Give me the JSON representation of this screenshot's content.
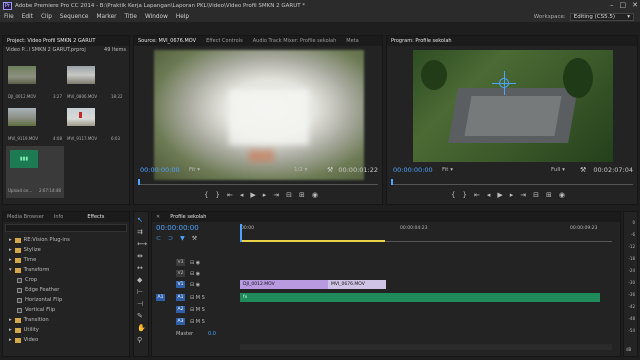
{
  "app": {
    "title": "Adobe Premiere Pro CC 2014 - B:\\Praktik Kerja Lapangan\\Laporan PKL\\Video\\Video Profil SMKN 2 GARUT *",
    "icon_label": "Pr",
    "window_buttons": [
      "–",
      "□",
      "✕"
    ]
  },
  "menu": [
    "File",
    "Edit",
    "Clip",
    "Sequence",
    "Marker",
    "Title",
    "Window",
    "Help"
  ],
  "workspace": {
    "label": "Workspace:",
    "value": "Editing (CS5.5)"
  },
  "project": {
    "tab": "Project: Video Profil SMKN 2 GARUT",
    "name": "Video P...l SMKN 2 GARUT.prproj",
    "count": "49 Items",
    "items": [
      {
        "name": "DJI_0012.MOV",
        "dur": "3:27"
      },
      {
        "name": "MVI_0806.MOV",
        "dur": "18:22"
      },
      {
        "name": "MVI_9119.MOV",
        "dur": "4:08"
      },
      {
        "name": "MVI_9117.MOV",
        "dur": "6:03"
      },
      {
        "name": "Upload on...",
        "dur": "2:07:14:48"
      }
    ]
  },
  "source": {
    "tabs": [
      "Source: MVI_0676.MOV",
      "Effect Controls",
      "Audio Track Mixer: Profile sekolah",
      "Meta"
    ],
    "timecode": "00:00:00:00",
    "fit": "Fit",
    "ratio": "1/2",
    "duration": "00:00:01:22"
  },
  "program": {
    "tab": "Program: Profile sekolah",
    "timecode": "00:00:00:00",
    "fit": "Fit",
    "quality": "Full",
    "duration": "00:02:07:04"
  },
  "effects": {
    "tabs": [
      "Media Browser",
      "Info",
      "Effects"
    ],
    "items": [
      {
        "label": "RE:Vision Plug-ins",
        "kind": "folder",
        "indent": 0
      },
      {
        "label": "Stylize",
        "kind": "folder",
        "indent": 0
      },
      {
        "label": "Time",
        "kind": "folder",
        "indent": 0
      },
      {
        "label": "Transform",
        "kind": "folder",
        "indent": 0
      },
      {
        "label": "Crop",
        "kind": "fx",
        "indent": 1
      },
      {
        "label": "Edge Feather",
        "kind": "fx",
        "indent": 1
      },
      {
        "label": "Horizontal Flip",
        "kind": "fx",
        "indent": 1
      },
      {
        "label": "Vertical Flip",
        "kind": "fx",
        "indent": 1
      },
      {
        "label": "Transition",
        "kind": "folder",
        "indent": 0
      },
      {
        "label": "Utility",
        "kind": "folder",
        "indent": 0
      },
      {
        "label": "Video",
        "kind": "folder",
        "indent": 0
      }
    ]
  },
  "timeline": {
    "tab": "Profile sekolah",
    "timecode": "00:00:00:00",
    "ruler": [
      "00:00",
      "00:00:04:23",
      "00:00:09:23"
    ],
    "video_tracks": [
      "V3",
      "V2",
      "V1"
    ],
    "audio_tracks": [
      "A1",
      "A2",
      "A3"
    ],
    "master": "Master",
    "master_val": "0.0",
    "clips": {
      "v1a": "DJI_0012.MOV",
      "v1b": "MVI_0676.MOV",
      "a1": "fx"
    }
  },
  "meter": {
    "labels": [
      "0",
      "-6",
      "-12",
      "-18",
      "-24",
      "-30",
      "-36",
      "-42",
      "-48",
      "-54"
    ],
    "unit": "dB"
  }
}
